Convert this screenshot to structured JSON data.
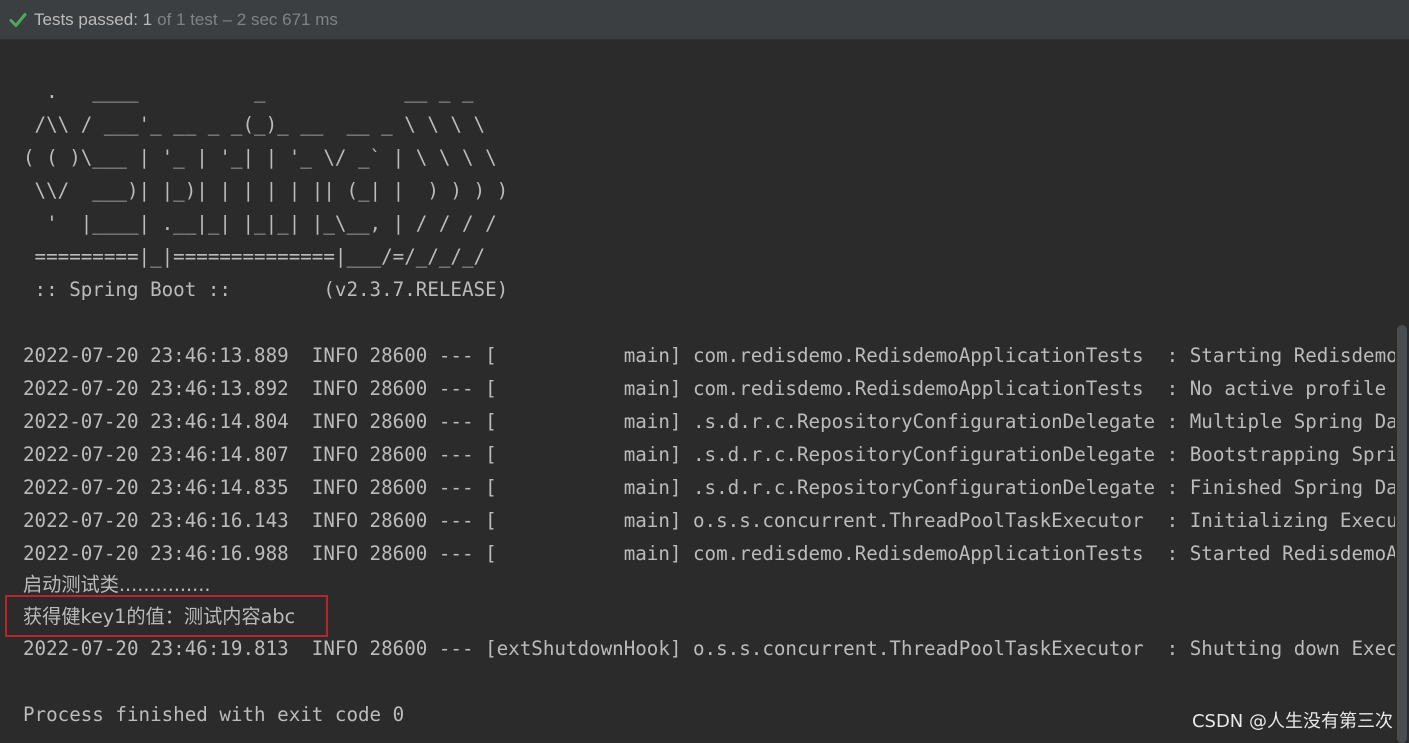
{
  "status": {
    "icon": "check-icon",
    "icon_color": "#4fa85f",
    "passed_label": "Tests passed: 1",
    "total_label": "of 1 test",
    "duration_label": "– 2 sec 671 ms"
  },
  "console": {
    "banner": [
      "  .   ____          _            __ _ _",
      " /\\\\ / ___'_ __ _ _(_)_ __  __ _ \\ \\ \\ \\",
      "( ( )\\___ | '_ | '_| | '_ \\/ _` | \\ \\ \\ \\",
      " \\\\/  ___)| |_)| | | | | || (_| |  ) ) ) )",
      "  '  |____| .__|_| |_|_| |_\\__, | / / / /",
      " =========|_|==============|___/=/_/_/_/",
      " :: Spring Boot ::        (v2.3.7.RELEASE)"
    ],
    "logs": [
      "2022-07-20 23:46:13.889  INFO 28600 --- [           main] com.redisdemo.RedisdemoApplicationTests  : Starting RedisdemoApplicationTests",
      "2022-07-20 23:46:13.892  INFO 28600 --- [           main] com.redisdemo.RedisdemoApplicationTests  : No active profile set",
      "2022-07-20 23:46:14.804  INFO 28600 --- [           main] .s.d.r.c.RepositoryConfigurationDelegate : Multiple Spring Data modules found",
      "2022-07-20 23:46:14.807  INFO 28600 --- [           main] .s.d.r.c.RepositoryConfigurationDelegate : Bootstrapping Spring Data",
      "2022-07-20 23:46:14.835  INFO 28600 --- [           main] .s.d.r.c.RepositoryConfigurationDelegate : Finished Spring Data repository scanning",
      "2022-07-20 23:46:16.143  INFO 28600 --- [           main] o.s.s.concurrent.ThreadPoolTaskExecutor  : Initializing ExecutorService",
      "2022-07-20 23:46:16.988  INFO 28600 --- [           main] com.redisdemo.RedisdemoApplicationTests  : Started RedisdemoApplicationTests"
    ],
    "output_1": "启动测试类...............",
    "output_2": "获得健key1的值：测试内容abc",
    "shutdown_log": "2022-07-20 23:46:19.813  INFO 28600 --- [extShutdownHook] o.s.s.concurrent.ThreadPoolTaskExecutor  : Shutting down ExecutorService",
    "exit_message": "Process finished with exit code 0"
  },
  "watermark": "CSDN @人生没有第三次",
  "colors": {
    "background": "#2b2b2b",
    "toolbar": "#3c3f41",
    "text": "#bbbbbb",
    "highlight_border": "#b8262d"
  }
}
